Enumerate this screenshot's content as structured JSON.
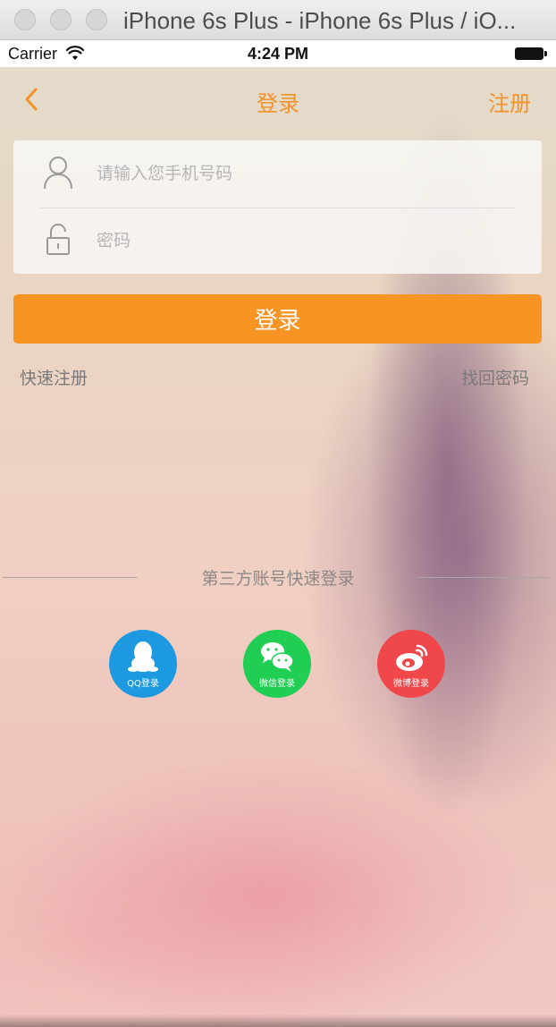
{
  "window": {
    "title": "iPhone 6s Plus - iPhone 6s Plus / iO..."
  },
  "status_bar": {
    "carrier": "Carrier",
    "time": "4:24 PM"
  },
  "nav": {
    "title": "登录",
    "register": "注册",
    "back_icon": "chevron-left-icon"
  },
  "form": {
    "phone_placeholder": "请输入您手机号码",
    "phone_value": "",
    "password_placeholder": "密码",
    "password_value": ""
  },
  "actions": {
    "login": "登录",
    "quick_register": "快速注册",
    "forgot_password": "找回密码"
  },
  "third_party": {
    "title": "第三方账号快速登录",
    "providers": [
      {
        "label": "QQ登录",
        "icon": "qq-penguin-icon",
        "color": "#1c99e1"
      },
      {
        "label": "微信登录",
        "icon": "wechat-icon",
        "color": "#1fce53"
      },
      {
        "label": "微博登录",
        "icon": "weibo-icon",
        "color": "#f0474b"
      }
    ]
  },
  "colors": {
    "accent": "#f39227",
    "button": "#f79424"
  }
}
